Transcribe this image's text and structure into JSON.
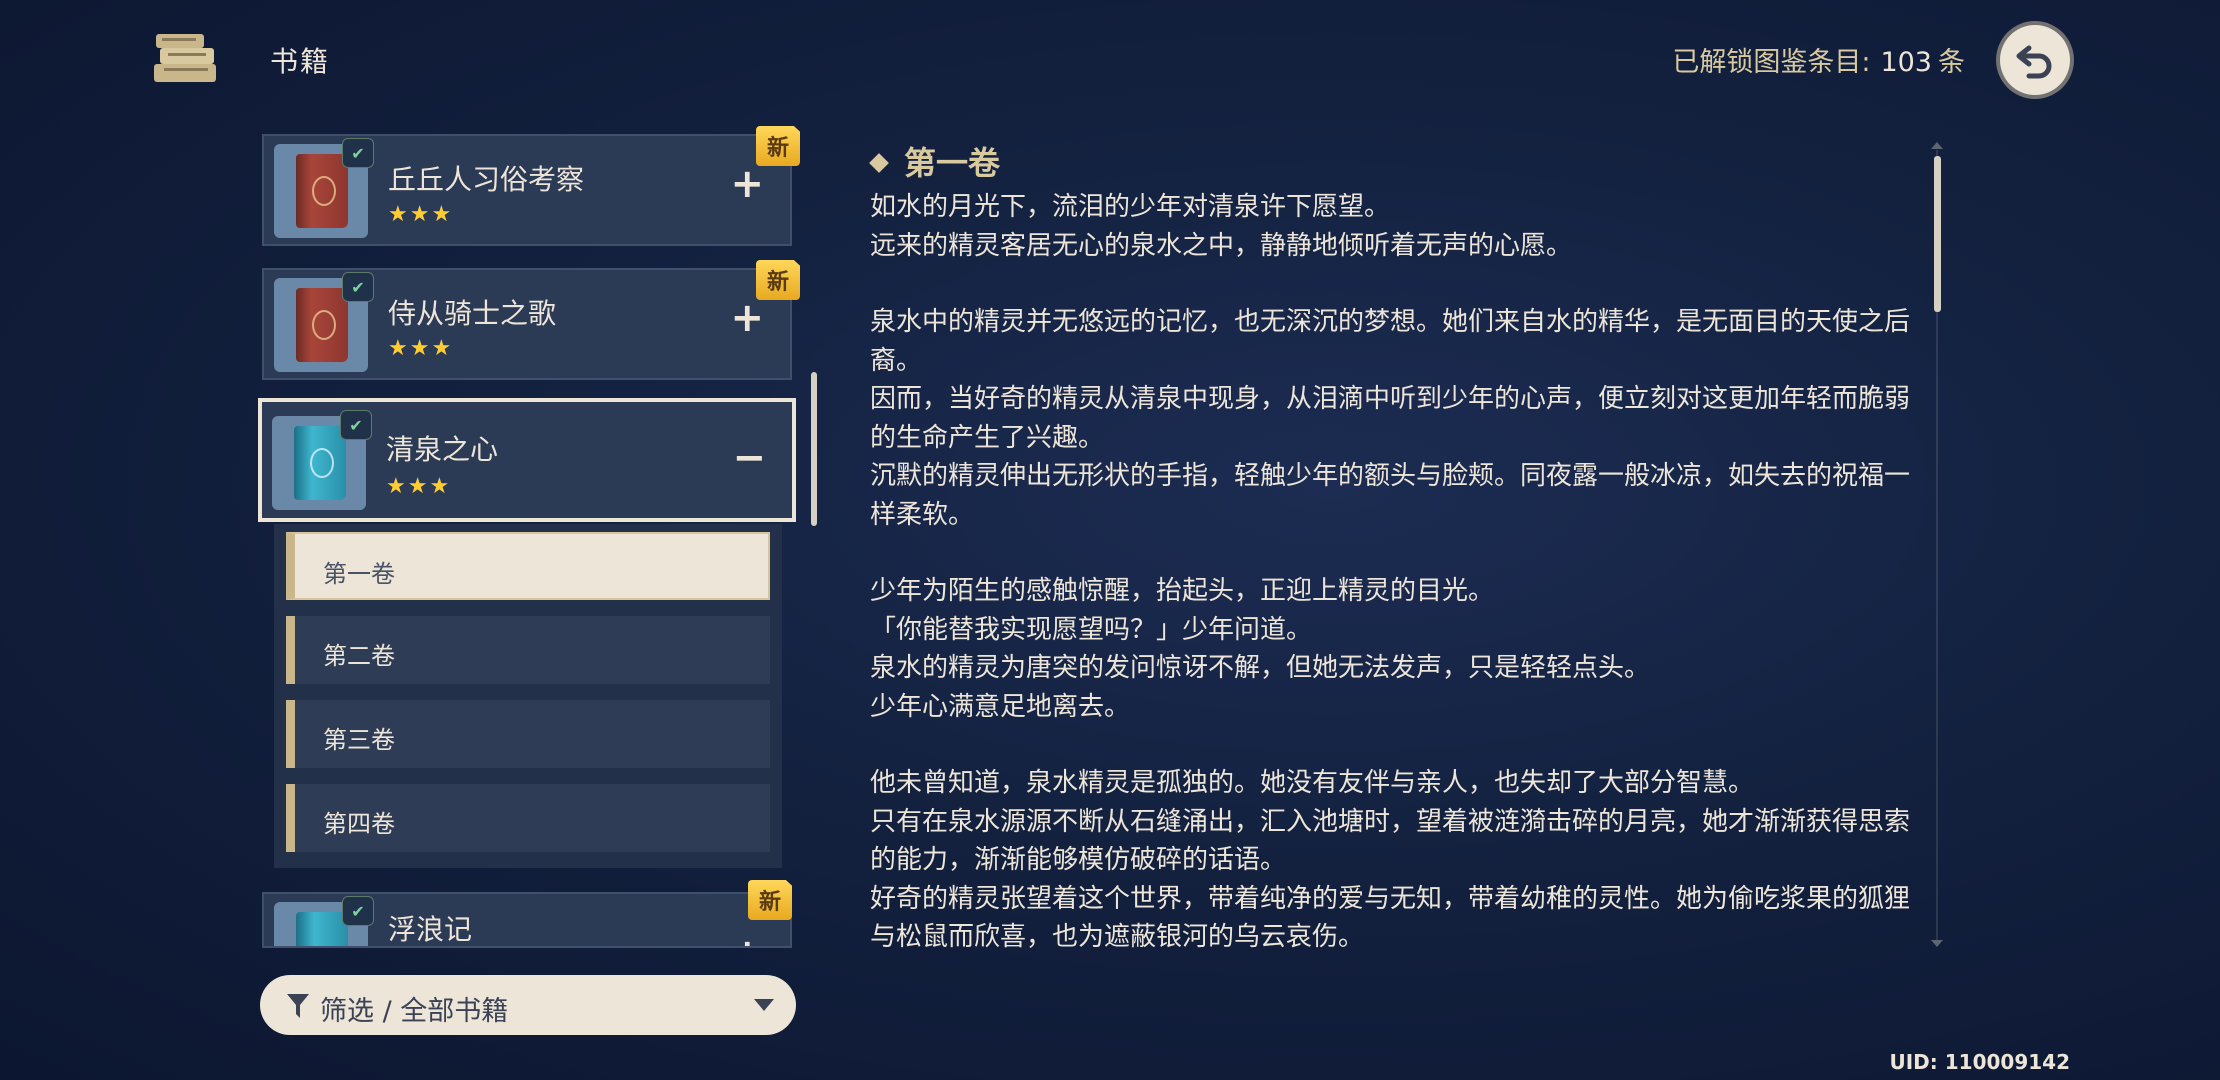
{
  "header": {
    "title": "书籍",
    "unlock_label": "已解锁图鉴条目:",
    "unlock_count": "103",
    "unlock_unit": "条"
  },
  "books": [
    {
      "name": "丘丘人习俗考察",
      "stars": "★★★",
      "toggle": "+",
      "badge": "新"
    },
    {
      "name": "侍从骑士之歌",
      "stars": "★★★",
      "toggle": "+",
      "badge": "新"
    },
    {
      "name": "清泉之心",
      "stars": "★★★",
      "toggle": "−"
    },
    {
      "name": "浮浪记",
      "badge": "新",
      "toggle": "+"
    }
  ],
  "volumes": [
    "第一卷",
    "第二卷",
    "第三卷",
    "第四卷"
  ],
  "filter": {
    "label": "筛选 / 全部书籍"
  },
  "reader": {
    "title": "第一卷",
    "paragraphs": [
      [
        "如水的月光下，流泪的少年对清泉许下愿望。",
        "远来的精灵客居无心的泉水之中，静静地倾听着无声的心愿。"
      ],
      [
        "泉水中的精灵并无悠远的记忆，也无深沉的梦想。她们来自水的精华，是无面目的天使之后裔。",
        "因而，当好奇的精灵从清泉中现身，从泪滴中听到少年的心声，便立刻对这更加年轻而脆弱的生命产生了兴趣。",
        "沉默的精灵伸出无形状的手指，轻触少年的额头与脸颊。同夜露一般冰凉，如失去的祝福一样柔软。"
      ],
      [
        "少年为陌生的感触惊醒，抬起头，正迎上精灵的目光。",
        "「你能替我实现愿望吗？」少年问道。",
        "泉水的精灵为唐突的发问惊讶不解，但她无法发声，只是轻轻点头。",
        "少年心满意足地离去。"
      ],
      [
        "他未曾知道，泉水精灵是孤独的。她没有友伴与亲人，也失却了大部分智慧。",
        "只有在泉水源源不断从石缝涌出，汇入池塘时，望着被涟漪击碎的月亮，她才渐渐获得思索的能力，渐渐能够模仿破碎的话语。",
        "好奇的精灵张望着这个世界，带着纯净的爱与无知，带着幼稚的灵性。她为偷吃浆果的狐狸与松鼠而欣喜，也为遮蔽银河的乌云哀伤。"
      ]
    ]
  },
  "uid": "UID: 110009142"
}
